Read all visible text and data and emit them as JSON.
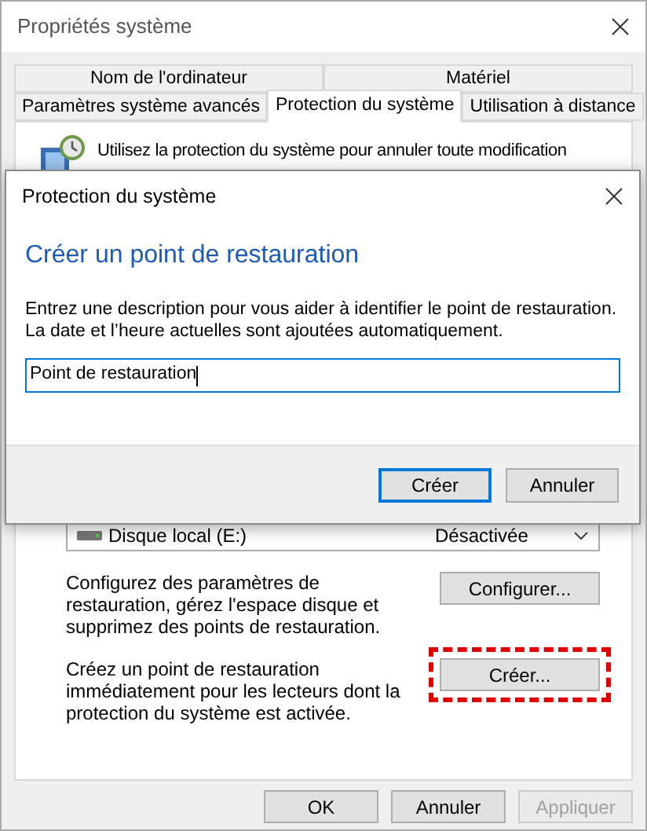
{
  "window": {
    "title": "Propriétés système"
  },
  "tab_rows": [
    [
      {
        "label": "Nom de l'ordinateur",
        "selected": false
      },
      {
        "label": "Matériel",
        "selected": false
      }
    ],
    [
      {
        "label": "Paramètres système avancés",
        "selected": false
      },
      {
        "label": "Protection du système",
        "selected": true
      },
      {
        "label": "Utilisation à distance",
        "selected": false
      }
    ]
  ],
  "intro": "Utilisez la protection du système pour annuler toute modification",
  "drive": {
    "name": "Disque local (E:)",
    "status": "Désactivée"
  },
  "actions": [
    {
      "text": "Configurez des paramètres de restauration, gérez l'espace disque et supprimez des points de restauration.",
      "button": "Configurer...",
      "highlighted": false
    },
    {
      "text": "Créez un point de restauration immédiatement pour les lecteurs dont la protection du système est activée.",
      "button": "Créer...",
      "highlighted": true
    }
  ],
  "footer_buttons": [
    {
      "label": "OK",
      "disabled": false
    },
    {
      "label": "Annuler",
      "disabled": false
    },
    {
      "label": "Appliquer",
      "disabled": true
    }
  ],
  "dialog": {
    "title": "Protection du système",
    "heading": "Créer un point de restauration",
    "description": "Entrez une description pour vous aider à identifier le point de restauration. La date et l’heure actuelles sont ajoutées automatiquement.",
    "input": {
      "value": "Point de restauration"
    },
    "buttons": [
      {
        "label": "Créer",
        "default": true
      },
      {
        "label": "Annuler",
        "default": false
      }
    ]
  }
}
